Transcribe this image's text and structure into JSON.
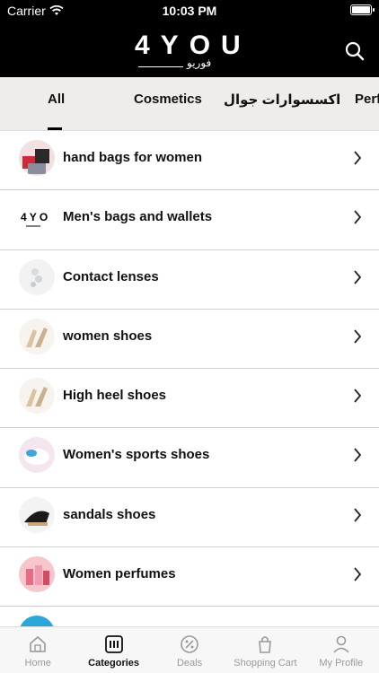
{
  "status": {
    "carrier": "Carrier",
    "time": "10:03 PM"
  },
  "header": {
    "logo_text": "4YOU",
    "logo_subtitle": "فوريو"
  },
  "category_tabs": [
    {
      "label": "All"
    },
    {
      "label": "Cosmetics"
    },
    {
      "label": "اكسسوارات جوال"
    },
    {
      "label": "Perfu"
    }
  ],
  "categories": [
    {
      "label": "hand bags for women"
    },
    {
      "label": "Men's bags and wallets"
    },
    {
      "label": "Contact lenses"
    },
    {
      "label": "women shoes"
    },
    {
      "label": "High heel shoes"
    },
    {
      "label": "Women's sports shoes"
    },
    {
      "label": "sandals shoes"
    },
    {
      "label": "Women perfumes"
    },
    {
      "label": ""
    }
  ],
  "tabbar": [
    {
      "label": "Home",
      "icon": "home-icon"
    },
    {
      "label": "Categories",
      "icon": "categories-icon"
    },
    {
      "label": "Deals",
      "icon": "deals-icon"
    },
    {
      "label": "Shopping Cart",
      "icon": "cart-icon"
    },
    {
      "label": "My Profile",
      "icon": "profile-icon"
    }
  ],
  "colors": {
    "header_bg": "#000000",
    "tabs_bg": "#efedec",
    "active": "#111111",
    "inactive": "#9a9a9a"
  }
}
